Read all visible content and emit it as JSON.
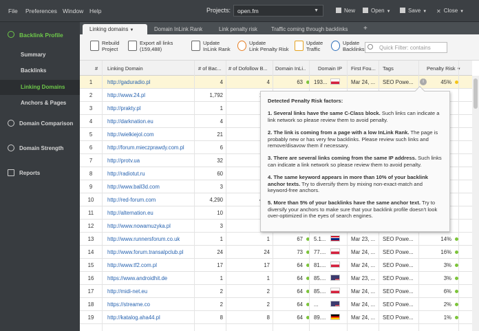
{
  "menu": {
    "file": "File",
    "preferences": "Preferences",
    "window": "Window",
    "help": "Help"
  },
  "projects": {
    "label": "Projects:",
    "value": "open.fm"
  },
  "top_actions": {
    "new": "New",
    "open": "Open",
    "save": "Save",
    "close": "Close"
  },
  "sidebar": {
    "module": "Backlink Profile",
    "items": [
      {
        "label": "Summary"
      },
      {
        "label": "Backlinks"
      },
      {
        "label": "Linking Domains",
        "active": true
      },
      {
        "label": "Anchors & Pages"
      }
    ],
    "sections": [
      {
        "label": "Domain Comparison"
      },
      {
        "label": "Domain Strength"
      },
      {
        "label": "Reports"
      }
    ]
  },
  "tabs": [
    {
      "label": "Linking domains",
      "active": true
    },
    {
      "label": "Domain InLink Rank"
    },
    {
      "label": "Link penalty risk"
    },
    {
      "label": "Traffic coming through backlinks"
    },
    {
      "label": "+"
    }
  ],
  "toolbar": {
    "rebuild": "Rebuild",
    "rebuild2": "Project",
    "export": "Export all links",
    "export2": "(159,488)",
    "upd_inlink": "Update",
    "upd_inlink2": "InLink Rank",
    "upd_penalty": "Update",
    "upd_penalty2": "Link Penalty Risk",
    "upd_traffic": "Update",
    "upd_traffic2": "Traffic",
    "upd_backlinks": "Update",
    "upd_backlinks2": "Backlinks",
    "filter_placeholder": "Quick Filter: contains"
  },
  "columns": [
    "#",
    "Linking Domain",
    "# of Bac...",
    "# of Dofollow B...",
    "Domain InLi...",
    "Domain IP",
    "First Fou...",
    "Tags",
    "Penalty Risk"
  ],
  "rows": [
    {
      "n": "1",
      "domain": "http://gaduradio.pl",
      "bac": "4",
      "dof": "4",
      "inl": "63",
      "ip": "193...",
      "first": "Mar 24, ...",
      "tags": "SEO Powe...",
      "risk": "45%"
    },
    {
      "n": "2",
      "domain": "http://www.24.pl",
      "bac": "1,792",
      "dof": "1,79",
      "inl": "",
      "ip": "",
      "first": "",
      "tags": "",
      "risk": ""
    },
    {
      "n": "3",
      "domain": "http://prakty.pl",
      "bac": "1",
      "dof": "",
      "inl": "",
      "ip": "",
      "first": "",
      "tags": "",
      "risk": ""
    },
    {
      "n": "4",
      "domain": "http://darknation.eu",
      "bac": "4",
      "dof": "",
      "inl": "",
      "ip": "",
      "first": "",
      "tags": "",
      "risk": ""
    },
    {
      "n": "5",
      "domain": "http://wielkiejol.com",
      "bac": "21",
      "dof": "2",
      "inl": "",
      "ip": "",
      "first": "",
      "tags": "",
      "risk": ""
    },
    {
      "n": "6",
      "domain": "http://forum.mieczprawdy.com.pl",
      "bac": "6",
      "dof": "",
      "inl": "",
      "ip": "",
      "first": "",
      "tags": "",
      "risk": ""
    },
    {
      "n": "7",
      "domain": "http://protv.ua",
      "bac": "32",
      "dof": "3",
      "inl": "",
      "ip": "",
      "first": "",
      "tags": "",
      "risk": ""
    },
    {
      "n": "8",
      "domain": "http://radiotut.ru",
      "bac": "60",
      "dof": "6",
      "inl": "",
      "ip": "",
      "first": "",
      "tags": "",
      "risk": ""
    },
    {
      "n": "9",
      "domain": "http://www.ball3d.com",
      "bac": "3",
      "dof": "",
      "inl": "",
      "ip": "",
      "first": "",
      "tags": "",
      "risk": ""
    },
    {
      "n": "10",
      "domain": "http://red-forum.com",
      "bac": "4,290",
      "dof": "4,28",
      "inl": "",
      "ip": "",
      "first": "",
      "tags": "",
      "risk": ""
    },
    {
      "n": "11",
      "domain": "http://alternation.eu",
      "bac": "10",
      "dof": "",
      "inl": "",
      "ip": "",
      "first": "",
      "tags": "",
      "risk": ""
    },
    {
      "n": "12",
      "domain": "http://www.nowamuzyka.pl",
      "bac": "3",
      "dof": "",
      "inl": "",
      "ip": "",
      "first": "",
      "tags": "",
      "risk": ""
    },
    {
      "n": "13",
      "domain": "http://www.runnersforum.co.uk",
      "bac": "1",
      "dof": "1",
      "inl": "67",
      "ip": "5.1...",
      "first": "Mar 23, ...",
      "tags": "SEO Powe...",
      "risk": "14%"
    },
    {
      "n": "14",
      "domain": "http://www.forum.transalpclub.pl",
      "bac": "24",
      "dof": "24",
      "inl": "73",
      "ip": "77....",
      "first": "Mar 24, ...",
      "tags": "SEO Powe...",
      "risk": "16%"
    },
    {
      "n": "15",
      "domain": "http://www.tf2.com.pl",
      "bac": "17",
      "dof": "17",
      "inl": "64",
      "ip": "81....",
      "first": "Mar 24, ...",
      "tags": "SEO Powe...",
      "risk": "3%"
    },
    {
      "n": "16",
      "domain": "https://www.androidhit.de",
      "bac": "1",
      "dof": "1",
      "inl": "64",
      "ip": "85....",
      "first": "Mar 23, ...",
      "tags": "SEO Powe...",
      "risk": "3%"
    },
    {
      "n": "17",
      "domain": "http://midi-net.eu",
      "bac": "2",
      "dof": "2",
      "inl": "64",
      "ip": "85....",
      "first": "Mar 24, ...",
      "tags": "SEO Powe...",
      "risk": "6%"
    },
    {
      "n": "18",
      "domain": "https://streame.co",
      "bac": "2",
      "dof": "2",
      "inl": "64",
      "ip": "...",
      "first": "Mar 24, ...",
      "tags": "SEO Powe...",
      "risk": "2%"
    },
    {
      "n": "19",
      "domain": "http://katalog.aha44.pl",
      "bac": "8",
      "dof": "8",
      "inl": "64",
      "ip": "89....",
      "first": "Mar 24, ...",
      "tags": "SEO Powe...",
      "risk": "1%"
    }
  ],
  "tooltip": {
    "title": "Detected Penalty Risk factors:",
    "f1_b": "1. Several links have the same C-Class block.",
    "f1": " Such links can indicate a link network so please review them to avoid penalty.",
    "f2_b": "2. The link is coming from a page with a low InLink Rank.",
    "f2": " The page is probably new or has very few backlinks. Please review such links and remove/disavow them if necessary.",
    "f3_b": "3. There are several links coming from the same IP address.",
    "f3": " Such links can indicate a link network so please review them to avoid penalty.",
    "f4_b": "4. The same keyword appears in more than 10% of your backlink anchor texts.",
    "f4": " Try to diversify them by mixing non-exact-match and keyword-free anchors.",
    "f5_b": "5. More than 5% of your backlinks have the same anchor text.",
    "f5": " Try to diversify your anchors to make sure that your backlink profile doesn't look over-optimized in the eyes of search engines."
  },
  "colors": {
    "accent": "#6ec84a",
    "dot_green": "#7cc43a",
    "dot_yellow": "#f5c518"
  }
}
